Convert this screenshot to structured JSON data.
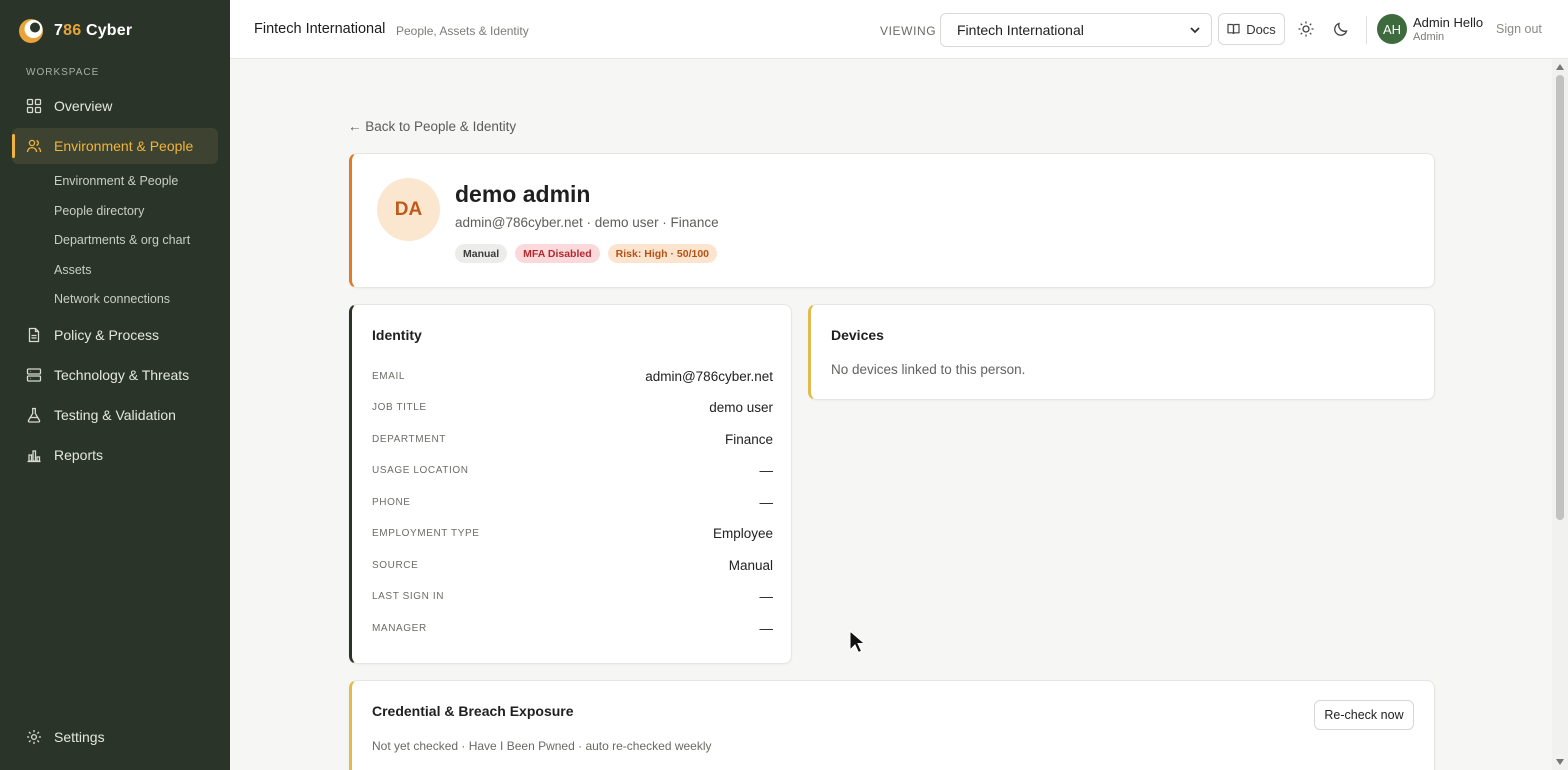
{
  "brand": {
    "name_prefix": "7",
    "name_highlight": "86",
    "name_suffix": " Cyber",
    "accent": "#e8a33a"
  },
  "sidebar": {
    "section_label": "WORKSPACE",
    "items": [
      {
        "label": "Overview",
        "icon": "grid-icon"
      },
      {
        "label": "Environment & People",
        "icon": "users-icon",
        "active": true
      },
      {
        "label": "Policy & Process",
        "icon": "document-icon"
      },
      {
        "label": "Technology & Threats",
        "icon": "server-icon"
      },
      {
        "label": "Testing & Validation",
        "icon": "flask-icon"
      },
      {
        "label": "Reports",
        "icon": "chart-icon"
      }
    ],
    "subitems": [
      "Environment & People",
      "People directory",
      "Departments & org chart",
      "Assets",
      "Network connections"
    ],
    "settings_label": "Settings"
  },
  "topbar": {
    "title": "Fintech International",
    "subtitle": "People, Assets & Identity",
    "viewing_label": "VIEWING",
    "org_selected": "Fintech International",
    "docs_label": "Docs",
    "user_initials": "AH",
    "user_name": "Admin Hello",
    "user_role": "Admin",
    "signout_label": "Sign out"
  },
  "back_link": "← Back to People & Identity",
  "person": {
    "initials": "DA",
    "name": "demo admin",
    "meta": "admin@786cyber.net · demo user · Finance",
    "badges": [
      "Manual",
      "MFA Disabled",
      "Risk: High · 50/100"
    ]
  },
  "identity": {
    "title": "Identity",
    "fields": [
      {
        "label": "EMAIL",
        "value": "admin@786cyber.net"
      },
      {
        "label": "JOB TITLE",
        "value": "demo user"
      },
      {
        "label": "DEPARTMENT",
        "value": "Finance"
      },
      {
        "label": "USAGE LOCATION",
        "value": "—"
      },
      {
        "label": "PHONE",
        "value": "—"
      },
      {
        "label": "EMPLOYMENT TYPE",
        "value": "Employee"
      },
      {
        "label": "SOURCE",
        "value": "Manual"
      },
      {
        "label": "LAST SIGN IN",
        "value": "—"
      },
      {
        "label": "MANAGER",
        "value": "—"
      }
    ]
  },
  "devices": {
    "title": "Devices",
    "empty": "No devices linked to this person."
  },
  "credentials": {
    "title": "Credential & Breach Exposure",
    "subtitle": "Not yet checked · Have I Been Pwned · auto re-checked weekly",
    "button": "Re-check now"
  }
}
